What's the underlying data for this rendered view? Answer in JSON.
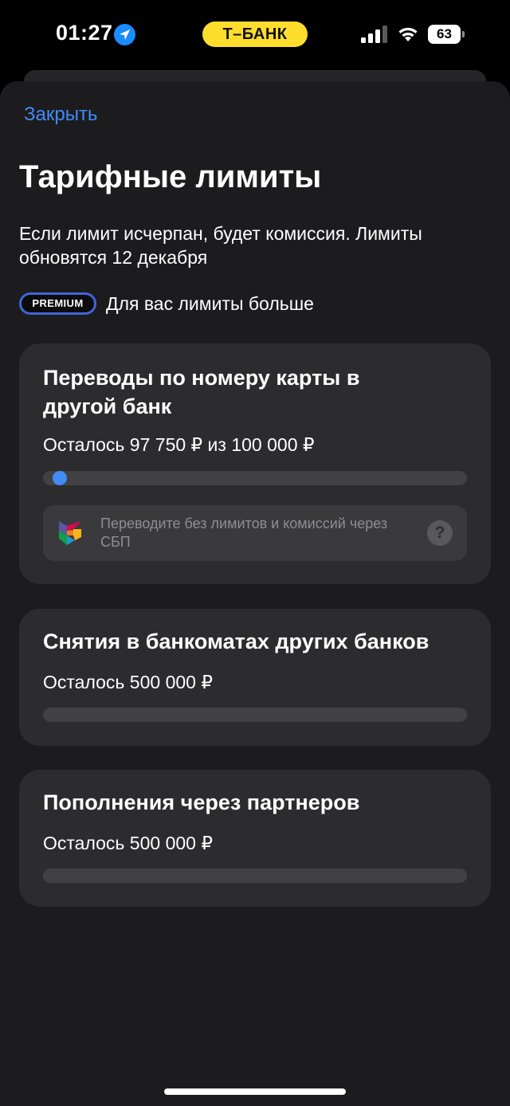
{
  "status_bar": {
    "time": "01:27",
    "bank": "Т–БАНК",
    "battery": "63"
  },
  "header": {
    "close_label": "Закрыть",
    "title": "Тарифные лимиты",
    "subtitle": "Если лимит исчерпан, будет комиссия. Лимиты обновятся 12 декабря"
  },
  "premium": {
    "badge": "PREMIUM",
    "note": "Для вас лимиты больше"
  },
  "limits": [
    {
      "title": "Переводы по номеру карты в другой банк",
      "remaining": "Осталось 97 750 ₽ из 100 000 ₽",
      "used_fraction": 0.0225,
      "hint": "Переводите без лимитов и комиссий через СБП"
    },
    {
      "title": "Снятия в банкоматах других банков",
      "remaining": "Осталось 500 000 ₽",
      "used_fraction": 0
    },
    {
      "title": "Пополнения через партнеров",
      "remaining": "Осталось 500 000 ₽",
      "used_fraction": 0
    }
  ],
  "colors": {
    "accent": "#428bf9",
    "bank_yellow": "#ffdd2d",
    "premium_blue": "#3f66d6",
    "sheet_bg": "#1c1c1e",
    "card_bg": "#2c2c2e"
  }
}
